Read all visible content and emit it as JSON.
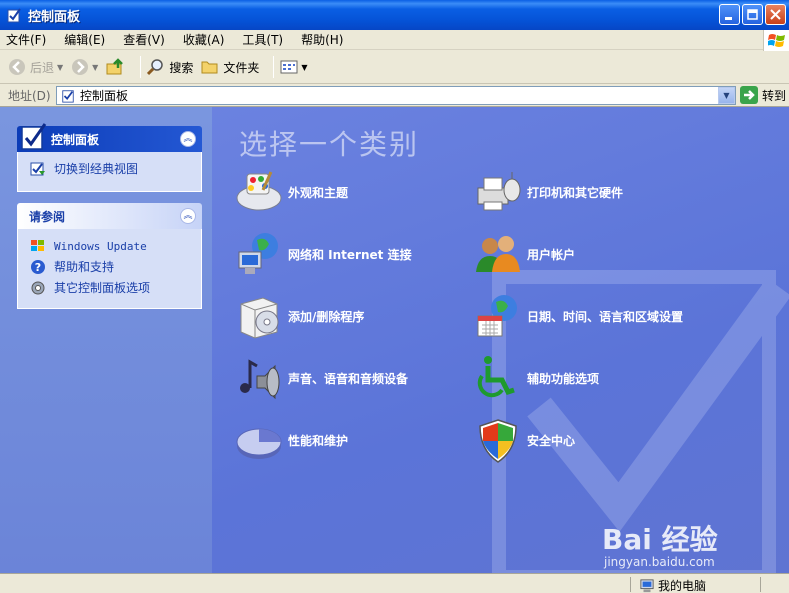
{
  "window": {
    "title": "控制面板"
  },
  "menu": [
    "文件(F)",
    "编辑(E)",
    "查看(V)",
    "收藏(A)",
    "工具(T)",
    "帮助(H)"
  ],
  "toolbar": {
    "back": "后退",
    "search": "搜索",
    "folders": "文件夹"
  },
  "address": {
    "label": "地址(D)",
    "value": "控制面板",
    "go": "转到"
  },
  "sidebar": {
    "control_panel": {
      "title": "控制面板",
      "switch_link": "切换到经典视图"
    },
    "see_also": {
      "title": "请参阅",
      "links": [
        "Windows Update",
        "帮助和支持",
        "其它控制面板选项"
      ]
    }
  },
  "main": {
    "heading": "选择一个类别",
    "categories": [
      "外观和主题",
      "打印机和其它硬件",
      "网络和 Internet 连接",
      "用户帐户",
      "添加/删除程序",
      "日期、时间、语言和区域设置",
      "声音、语音和音频设备",
      "辅助功能选项",
      "性能和维护",
      "安全中心"
    ]
  },
  "status": {
    "computer": "我的电脑"
  },
  "watermark": {
    "brand": "Bai 经验",
    "url": "jingyan.baidu.com"
  }
}
